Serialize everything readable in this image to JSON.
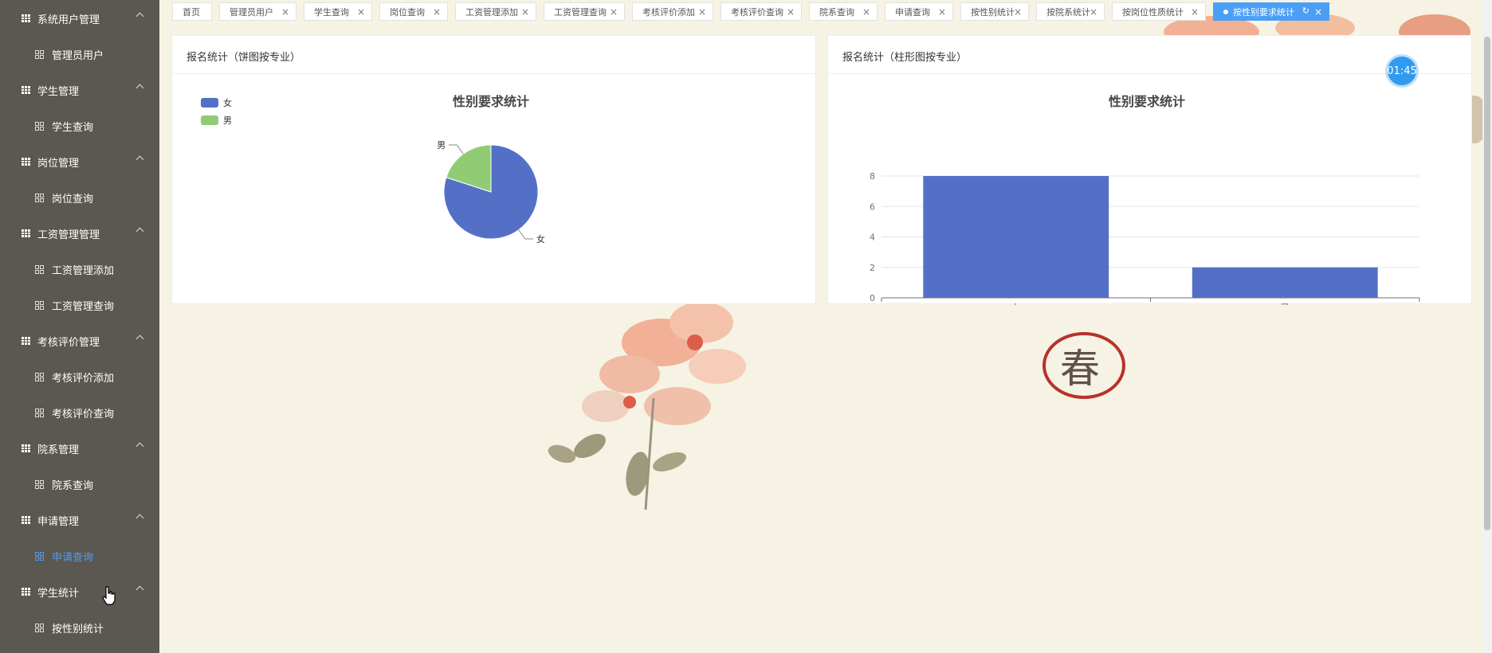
{
  "sidebar": {
    "groups": [
      {
        "label": "系统用户管理",
        "items": [
          {
            "label": "管理员用户",
            "active": false
          }
        ]
      },
      {
        "label": "学生管理",
        "items": [
          {
            "label": "学生查询",
            "active": false
          }
        ]
      },
      {
        "label": "岗位管理",
        "items": [
          {
            "label": "岗位查询",
            "active": false
          }
        ]
      },
      {
        "label": "工资管理管理",
        "items": [
          {
            "label": "工资管理添加",
            "active": false
          },
          {
            "label": "工资管理查询",
            "active": false
          }
        ]
      },
      {
        "label": "考核评价管理",
        "items": [
          {
            "label": "考核评价添加",
            "active": false
          },
          {
            "label": "考核评价查询",
            "active": false
          }
        ]
      },
      {
        "label": "院系管理",
        "items": [
          {
            "label": "院系查询",
            "active": false
          }
        ]
      },
      {
        "label": "申请管理",
        "items": [
          {
            "label": "申请查询",
            "active": true
          }
        ]
      },
      {
        "label": "学生统计",
        "items": [
          {
            "label": "按性别统计",
            "active": false
          }
        ]
      }
    ]
  },
  "tabs": [
    {
      "label": "首页",
      "closable": false
    },
    {
      "label": "管理员用户",
      "closable": true
    },
    {
      "label": "学生查询",
      "closable": true
    },
    {
      "label": "岗位查询",
      "closable": true
    },
    {
      "label": "工资管理添加",
      "closable": true
    },
    {
      "label": "工资管理查询",
      "closable": true
    },
    {
      "label": "考核评价添加",
      "closable": true
    },
    {
      "label": "考核评价查询",
      "closable": true
    },
    {
      "label": "院系查询",
      "closable": true
    },
    {
      "label": "申请查询",
      "closable": true
    },
    {
      "label": "按性别统计",
      "closable": true
    },
    {
      "label": "按院系统计",
      "closable": true
    },
    {
      "label": "按岗位性质统计",
      "closable": true
    },
    {
      "label": "按性别要求统计",
      "closable": true,
      "active": true
    }
  ],
  "close_glyph": "×",
  "refresh_glyph": "↻",
  "timer": "01:45",
  "panels": {
    "pie_title": "报名统计（饼图按专业）",
    "bar_title": "报名统计（柱形图按专业）"
  },
  "chart_data": [
    {
      "type": "pie",
      "title": "性别要求统计",
      "legend": [
        "女",
        "男"
      ],
      "legend_position": "top-left",
      "categories": [
        "女",
        "男"
      ],
      "values": [
        8,
        2
      ],
      "colors": [
        "#5470c6",
        "#91cc75"
      ]
    },
    {
      "type": "bar",
      "title": "性别要求统计",
      "categories": [
        "女",
        "男"
      ],
      "values": [
        8,
        2
      ],
      "ylim": [
        0,
        8
      ],
      "yticks": [
        0,
        2,
        4,
        6,
        8
      ],
      "grid": true,
      "color": "#5470c6"
    }
  ]
}
